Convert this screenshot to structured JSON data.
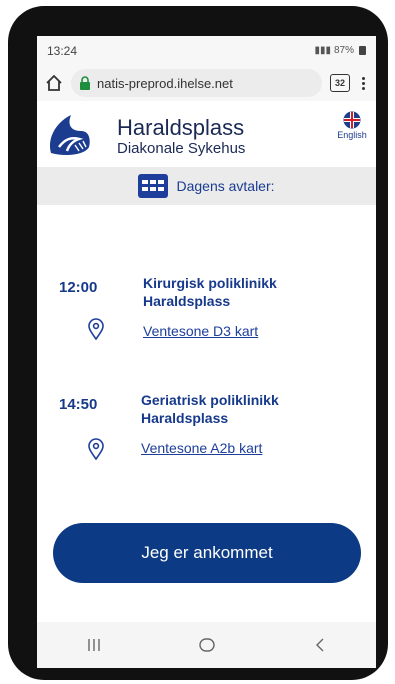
{
  "status": {
    "time": "13:24",
    "battery": "87%"
  },
  "browser": {
    "url": "natis-preprod.ihelse.net",
    "tab_count": "32"
  },
  "brand": {
    "name": "Haraldsplass",
    "subtitle": "Diakonale Sykehus",
    "language_label": "English"
  },
  "today_label": "Dagens avtaler:",
  "appointments": [
    {
      "time": "12:00",
      "clinic": "Kirurgisk poliklinikk Haraldsplass",
      "location_link": "Ventesone D3 kart"
    },
    {
      "time": "14:50",
      "clinic": "Geriatrisk poliklinikk Haraldsplass",
      "location_link": "Ventesone A2b kart"
    }
  ],
  "arrive_button": "Jeg er ankommet",
  "colors": {
    "brand_blue": "#0d3a84",
    "text_blue": "#17398b"
  },
  "icons": {
    "home": "home-icon",
    "lock": "lock-icon",
    "menu": "more-vertical-icon",
    "calendar": "calendar-grid-icon",
    "pin": "location-pin-icon",
    "flag": "uk-flag-icon"
  }
}
